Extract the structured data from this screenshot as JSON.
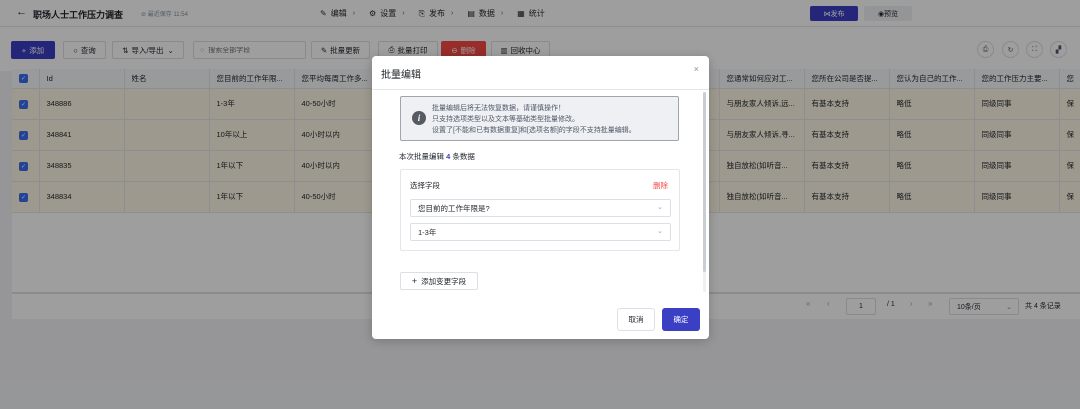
{
  "header": {
    "back_icon": "arrow-left-icon",
    "title": "职场人士工作压力调查",
    "saved": "最近保存 11:54",
    "nav": [
      {
        "icon": "edit-icon",
        "label": "编辑"
      },
      {
        "icon": "gear-icon",
        "label": "设置"
      },
      {
        "icon": "publish-icon",
        "label": "发布"
      },
      {
        "icon": "data-icon",
        "label": "数据"
      },
      {
        "icon": "stats-icon",
        "label": "统计"
      }
    ],
    "publish_label": "发布",
    "preview_label": "预览"
  },
  "toolbar": {
    "add_label": "添加",
    "query_label": "查询",
    "import_export_label": "导入/导出",
    "search_placeholder": "搜索全部字段",
    "batch_update_label": "批量更新",
    "batch_print_label": "批量打印",
    "delete_label": "删除",
    "recycle_label": "回收中心"
  },
  "table": {
    "headers": [
      "Id",
      "姓名",
      "您目前的工作年限...",
      "您平均每周工作多...",
      "",
      "",
      "",
      "",
      "您通常如何应对工...",
      "您所在公司是否提...",
      "您认为自己的工作...",
      "您的工作压力主要...",
      "您"
    ],
    "rows": [
      [
        "348886",
        "",
        "1-3年",
        "40-50小时",
        "",
        "",
        "",
        "",
        "与朋友家人倾诉,远...",
        "有基本支持",
        "略低",
        "同级同事",
        "保"
      ],
      [
        "348841",
        "",
        "10年以上",
        "40小时以内",
        "",
        "",
        "",
        "",
        "与朋友家人倾诉,寻...",
        "有基本支持",
        "略低",
        "同级同事",
        "保"
      ],
      [
        "348835",
        "",
        "1年以下",
        "40小时以内",
        "",
        "",
        "",
        "",
        "独自放松(如听音...",
        "有基本支持",
        "略低",
        "同级同事",
        "保"
      ],
      [
        "348834",
        "",
        "1年以下",
        "40-50小时",
        "",
        "",
        "",
        "",
        "独自放松(如听音...",
        "有基本支持",
        "略低",
        "同级同事",
        "保"
      ]
    ]
  },
  "pager": {
    "page": "1",
    "total_pages": "/ 1",
    "page_size": "10条/页",
    "total": "共 4 条记录"
  },
  "modal": {
    "title": "批量编辑",
    "notice_lines": [
      "批量编辑后将无法恢复数据，请谨慎操作！",
      "只支持选项类型以及文本等基础类型批量修改。",
      "设置了[不能和已有数据重复]和[选项名额]的字段不支持批量编辑。"
    ],
    "count_prefix": "本次批量编辑",
    "count_value": "4",
    "count_suffix": "条数据",
    "field_label": "选择字段",
    "delete_label": "删除",
    "field_select_value": "您目前的工作年限是?",
    "option_select_value": "1-3年",
    "add_field_label": "添加变更字段",
    "cancel_label": "取消",
    "confirm_label": "确定"
  }
}
